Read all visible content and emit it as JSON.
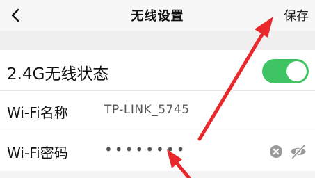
{
  "header": {
    "title": "无线设置",
    "save_label": "保存"
  },
  "wireless": {
    "status_label": "2.4G无线状态",
    "enabled": true
  },
  "ssid": {
    "label": "Wi-Fi名称",
    "value": "TP-LINK_5745"
  },
  "password": {
    "label": "Wi-Fi密码",
    "masked_value": "••••••••"
  },
  "icons": {
    "back": "chevron-left-icon",
    "clear": "clear-icon",
    "visibility": "eye-slash-icon"
  },
  "colors": {
    "toggle_on": "#3fc464",
    "annotation_arrow": "#e8282b"
  }
}
